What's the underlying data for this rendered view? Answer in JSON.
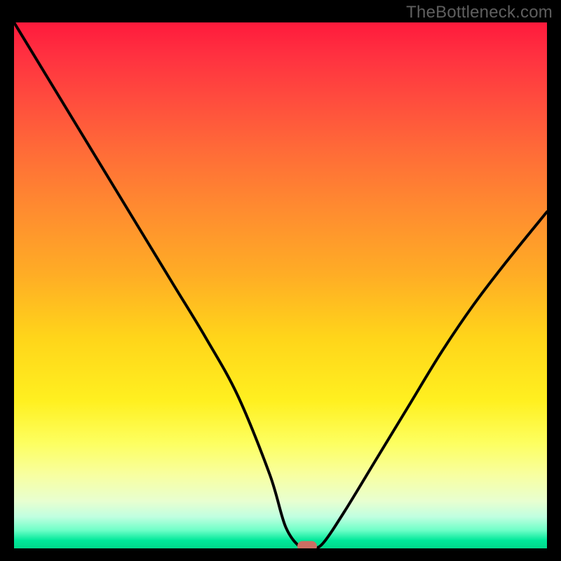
{
  "watermark": "TheBottleneck.com",
  "colors": {
    "frame_bg": "#000000",
    "curve_stroke": "#000000",
    "marker_fill": "#cc6e63",
    "watermark_color": "#5f5f5f",
    "gradient_stops": [
      "#ff1a3c",
      "#ff3040",
      "#ff4a3e",
      "#ff6a38",
      "#ff8a30",
      "#ffad25",
      "#ffd51a",
      "#fff020",
      "#fdff60",
      "#f8ffa0",
      "#e8ffd0",
      "#c0ffe0",
      "#70ffc8",
      "#00e89a",
      "#00d88a"
    ]
  },
  "chart_data": {
    "type": "line",
    "title": "",
    "xlabel": "",
    "ylabel": "",
    "xlim": [
      0,
      100
    ],
    "ylim": [
      0,
      100
    ],
    "grid": false,
    "series": [
      {
        "name": "bottleneck-curve",
        "x": [
          0,
          6,
          12,
          18,
          24,
          30,
          36,
          42,
          48,
          51,
          54,
          56,
          58,
          62,
          68,
          74,
          80,
          86,
          92,
          100
        ],
        "values": [
          100,
          90,
          80,
          70,
          60,
          50,
          40,
          29,
          14,
          4,
          0,
          0,
          1,
          7,
          17,
          27,
          37,
          46,
          54,
          64
        ]
      }
    ],
    "annotations": [
      {
        "name": "optimal-marker",
        "x": 55,
        "y": 0,
        "shape": "rounded-rect",
        "color": "#cc6e63"
      }
    ],
    "background_meaning": "vertical gradient red (high bottleneck) to green (no bottleneck)"
  }
}
